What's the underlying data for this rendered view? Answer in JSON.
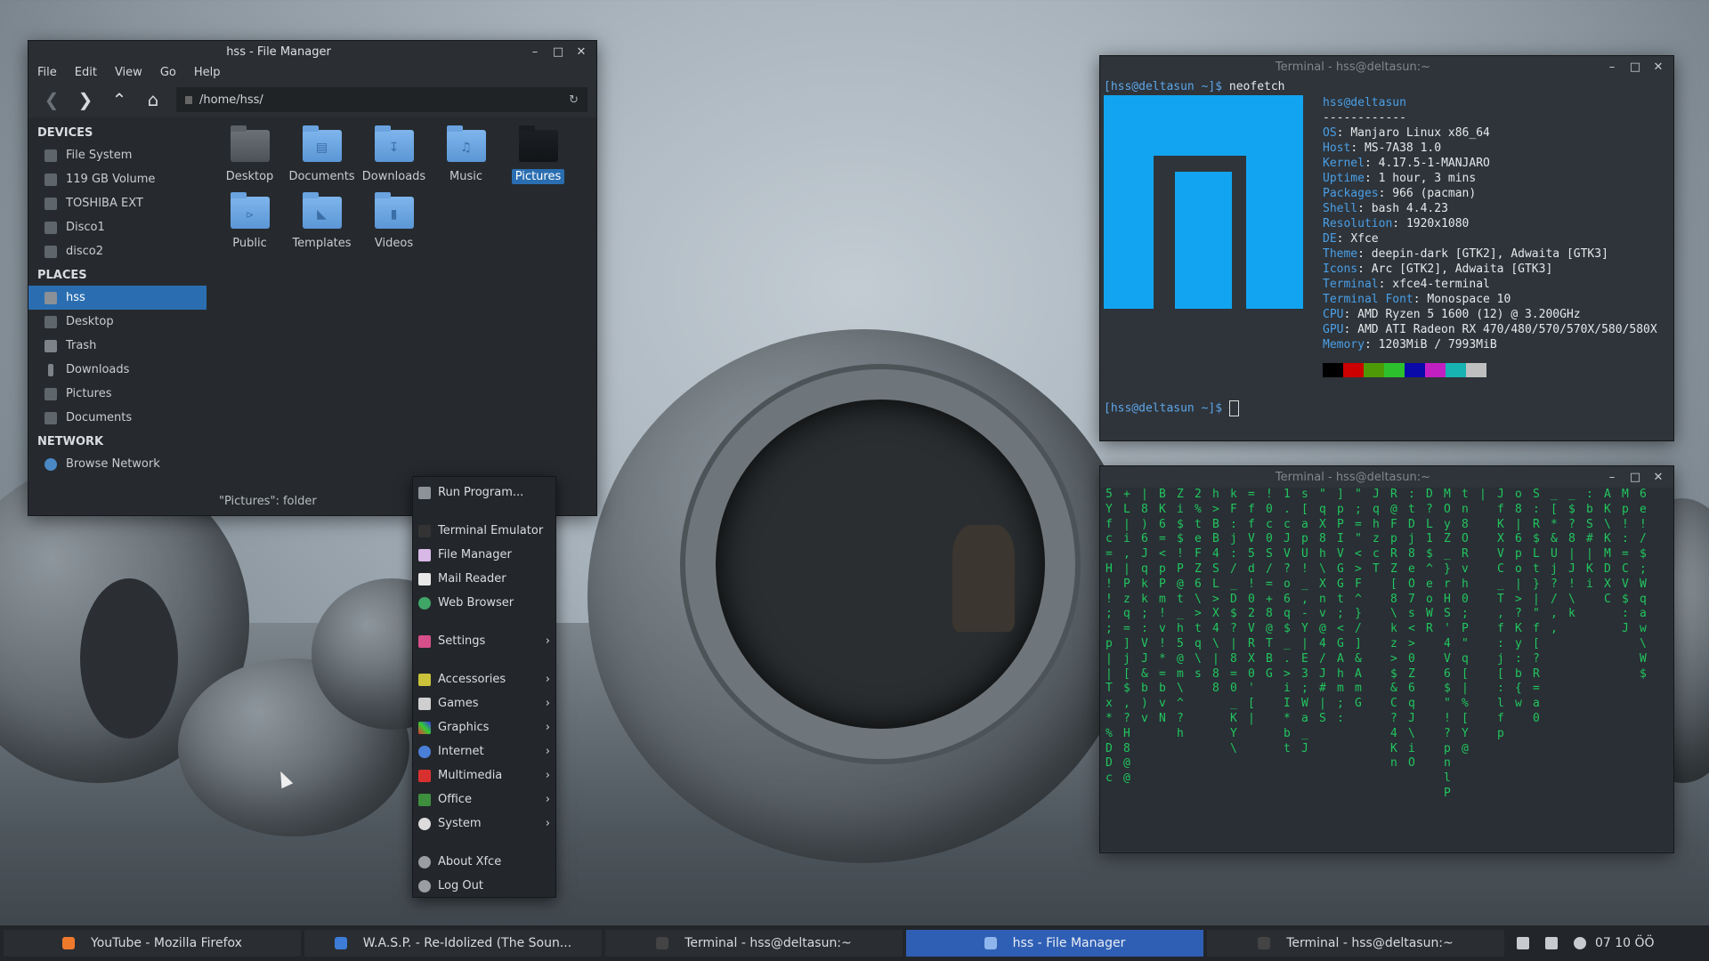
{
  "file_manager": {
    "title": "hss - File Manager",
    "menu": [
      "File",
      "Edit",
      "View",
      "Go",
      "Help"
    ],
    "path": "/home/hss/",
    "sidebar": {
      "devices_heading": "DEVICES",
      "devices": [
        "File System",
        "119 GB Volume",
        "TOSHIBA EXT",
        "Disco1",
        "disco2"
      ],
      "places_heading": "PLACES",
      "places": [
        "hss",
        "Desktop",
        "Trash",
        "Downloads",
        "Pictures",
        "Documents"
      ],
      "network_heading": "NETWORK",
      "network": [
        "Browse Network"
      ]
    },
    "items": [
      "Desktop",
      "Documents",
      "Downloads",
      "Music",
      "Pictures",
      "Public",
      "Templates",
      "Videos"
    ],
    "selected_item": "Pictures",
    "status": "\"Pictures\": folder"
  },
  "context_menu": {
    "items": [
      "Run Program...",
      "Terminal Emulator",
      "File Manager",
      "Mail Reader",
      "Web Browser",
      "Settings",
      "Accessories",
      "Games",
      "Graphics",
      "Internet",
      "Multimedia",
      "Office",
      "System",
      "About Xfce",
      "Log Out"
    ]
  },
  "terminal1": {
    "title": "Terminal - hss@deltasun:~",
    "prompt": "[hss@deltasun ~]$",
    "command": "neofetch",
    "user_host": "hss@deltasun",
    "separator": "------------",
    "info": [
      {
        "k": "OS",
        "v": "Manjaro Linux x86_64"
      },
      {
        "k": "Host",
        "v": "MS-7A38 1.0"
      },
      {
        "k": "Kernel",
        "v": "4.17.5-1-MANJARO"
      },
      {
        "k": "Uptime",
        "v": "1 hour, 3 mins"
      },
      {
        "k": "Packages",
        "v": "966 (pacman)"
      },
      {
        "k": "Shell",
        "v": "bash 4.4.23"
      },
      {
        "k": "Resolution",
        "v": "1920x1080"
      },
      {
        "k": "DE",
        "v": "Xfce"
      },
      {
        "k": "Theme",
        "v": "deepin-dark [GTK2], Adwaita [GTK3]"
      },
      {
        "k": "Icons",
        "v": "Arc [GTK2], Adwaita [GTK3]"
      },
      {
        "k": "Terminal",
        "v": "xfce4-terminal"
      },
      {
        "k": "Terminal Font",
        "v": "Monospace 10"
      },
      {
        "k": "CPU",
        "v": "AMD Ryzen 5 1600 (12) @ 3.200GHz"
      },
      {
        "k": "GPU",
        "v": "AMD ATI Radeon RX 470/480/570/570X/580/580X"
      },
      {
        "k": "Memory",
        "v": "1203MiB / 7993MiB"
      }
    ],
    "palette": [
      "#000000",
      "#cc0000",
      "#4e9a06",
      "#2cc12c",
      "#0a0aa8",
      "#c21fc2",
      "#17b3b3",
      "#bfbfbf"
    ],
    "logo_color": "#12a4f0"
  },
  "terminal2": {
    "title": "Terminal - hss@deltasun:~",
    "matrix_columns": [
      "5Yfc=H!!;;p||Tx*%DDc",
      "+L|i,|Pzq=]j[$,?H8@@",
      "|8)6Jqkk;:VJ&b)v",
      "BK6=<pPm!v!*=bvN",
      "Zi$$!P@t_h5@m\\^?h",
      "2%teFZ6\\>tq\\s",
      "h>BB4SL>X4\\|88",
      "kF:j:/_D$?|8=0_KY\\",
      "=ffV5d!02VRX0'[|",
      "!0c0S/=+8@TBG",
      "1.cJV?o6q$_.>iI*bt",
      "s[apU!_,-Y|E3;Wa_J",
      "\"qX8h\\Xnv@4/J#|S",
      "]pPIVGGt;<GAhm;:",
      "\";=\"<>F^}/]&AmG",
      "JqhzcT",
      "R@FpRZ[8\\kz>$&C?4Kn",
      ":tDj8eO7s<>0Z6qJ\\iO",
      "D?L1$^eoWR",
      "MOyZ_}rHS'4V6$\"!?pnlP",
      "tn8ORvh0;P\"q[|%[Y@",
      "|",
      "JfKXVC_T,f:j[:lfp",
      "o8|6po|>?Ky:b{w",
      "S:R$Lt}|\"f[?R=a0",
      "_[*&Uj?/,,",
      "_$?8|J!\\k",
      ":bS#|Ki",
      "AK\\KMDXC",
      "Mp!:=CV$:J",
      "6e!/$;Wqaw\\W$"
    ]
  },
  "taskbar": {
    "tasks": [
      "YouTube - Mozilla Firefox",
      "W.A.S.P. - Re-Idolized (The Soun...",
      "Terminal - hss@deltasun:~",
      "hss - File Manager",
      "Terminal - hss@deltasun:~"
    ],
    "active_index": 3,
    "clock": "07 10 ÖÖ"
  }
}
